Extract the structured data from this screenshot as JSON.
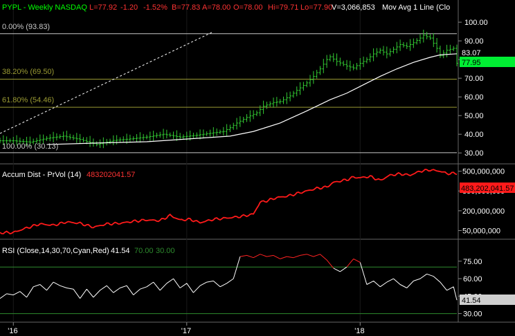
{
  "colors": {
    "background": "#000000",
    "grid": "#808080",
    "price_bars": "#33cc33",
    "moving_average": "#ffffff",
    "fib_lines": "#9a9a33",
    "trend_line": "#ffffff",
    "accum_dist": "#ff1a1a",
    "rsi_line": "#ffffff",
    "rsi_over": "#ff2222",
    "rsi_levels": "#2e8b2e",
    "label_green": "#00ff00",
    "label_red": "#ff3333",
    "label_orange": "#ff4d4d",
    "badge_bg": "#cfcfcf",
    "badge_green": "#00ee33"
  },
  "header": {
    "symbol": "PYPL - Weekly  NASDAQ",
    "last": "L=77.92",
    "change": "-1.20",
    "change_pct": "-1.52%",
    "bid": "B=77.83",
    "ask": "A=78.00",
    "open": "O=78.00",
    "high": "Hi=79.71",
    "low": "Lo=77.90",
    "volume": "V=3,066,853",
    "study": "Mov Avg 1 Line (Clo"
  },
  "price_panel": {
    "fib_labels": [
      "0.00% (93.83)",
      "38.20% (69.50)",
      "61.80% (54.46)",
      "100.00% (30.13)"
    ],
    "fib_values": [
      93.83,
      69.5,
      54.46,
      30.13
    ],
    "ma_badge": "83.07",
    "last_badge": "77.95",
    "ma_value": 83.07,
    "last_value": 77.95,
    "axis_ticks": [
      "100.00",
      "90.00",
      "80.00",
      "70.00",
      "60.00",
      "50.00",
      "40.00",
      "30.00"
    ],
    "tick_values": [
      100,
      90,
      80,
      70,
      60,
      50,
      40,
      30
    ]
  },
  "ad_panel": {
    "title": "Accum Dist - PrVol (14)",
    "value": "483202041.57",
    "badge": "483,202,041.57",
    "axis_ticks": [
      "500,000,000",
      "350,000,000",
      "200,000,000",
      "50,000,000"
    ],
    "tick_values": [
      500000000,
      350000000,
      200000000,
      50000000
    ]
  },
  "rsi_panel": {
    "title": "RSI (Close,14,30,70,Cyan,Red)",
    "value": "41.54",
    "upper": "70.00",
    "lower": "30.00",
    "badge": "41.54",
    "axis_ticks": [
      "75.00",
      "60.00",
      "45.00",
      "30.00"
    ],
    "tick_values": [
      75,
      60,
      45,
      30
    ]
  },
  "x_axis": {
    "labels": [
      "'16",
      "'17",
      "'18"
    ],
    "weeks": [
      0,
      52,
      104
    ]
  },
  "chart_data": [
    {
      "type": "line",
      "title": "PYPL - Weekly  NASDAQ",
      "series": [
        {
          "name": "Mov Avg 1 Line (Clo",
          "values": [
            [
              10,
              34.5
            ],
            [
              25,
              35.3
            ],
            [
              40,
              36.0
            ],
            [
              55,
              37.8
            ],
            [
              65,
              39.0
            ],
            [
              72,
              41.5
            ],
            [
              80,
              46.0
            ],
            [
              88,
              52.5
            ],
            [
              95,
              58.5
            ],
            [
              100,
              62.0
            ],
            [
              105,
              66.5
            ],
            [
              110,
              71.0
            ],
            [
              115,
              75.0
            ],
            [
              120,
              78.5
            ],
            [
              125,
              81.2
            ],
            [
              128,
              82.5
            ],
            [
              133,
              83.07
            ]
          ]
        }
      ],
      "price_path": [
        [
          0,
          36.5
        ],
        [
          5,
          35.8
        ],
        [
          10,
          37.8
        ],
        [
          15,
          39.0
        ],
        [
          20,
          37.2
        ],
        [
          25,
          34.5
        ],
        [
          30,
          36.7
        ],
        [
          35,
          37.5
        ],
        [
          40,
          38.5
        ],
        [
          45,
          40.0
        ],
        [
          50,
          38.5
        ],
        [
          55,
          39.5
        ],
        [
          60,
          40.8
        ],
        [
          63,
          41.5
        ],
        [
          65,
          43.5
        ],
        [
          67,
          46.0
        ],
        [
          70,
          49.0
        ],
        [
          73,
          51.5
        ],
        [
          75,
          55.0
        ],
        [
          78,
          57.0
        ],
        [
          80,
          57.5
        ],
        [
          83,
          60.5
        ],
        [
          85,
          63.5
        ],
        [
          88,
          67.5
        ],
        [
          90,
          71.0
        ],
        [
          92,
          75.0
        ],
        [
          94,
          80.0
        ],
        [
          95,
          81.5
        ],
        [
          97,
          79.0
        ],
        [
          100,
          76.5
        ],
        [
          102,
          75.5
        ],
        [
          104,
          78.0
        ],
        [
          106,
          80.0
        ],
        [
          108,
          83.0
        ],
        [
          110,
          85.0
        ],
        [
          112,
          83.0
        ],
        [
          114,
          85.5
        ],
        [
          116,
          88.0
        ],
        [
          118,
          87.0
        ],
        [
          120,
          89.0
        ],
        [
          122,
          91.5
        ],
        [
          123,
          93.0
        ],
        [
          125,
          91.5
        ],
        [
          127,
          86.0
        ],
        [
          128,
          82.0
        ],
        [
          130,
          85.0
        ],
        [
          132,
          86.0
        ],
        [
          133,
          78.0
        ]
      ],
      "fib_levels": [
        93.83,
        69.5,
        54.46,
        30.13
      ],
      "ylim": [
        26,
        103
      ],
      "x_range_weeks": [
        -4,
        133
      ]
    },
    {
      "type": "line",
      "title": "Accum Dist - PrVol (14)",
      "series": [
        {
          "name": "Accum Dist - PrVol (14)",
          "values": [
            [
              -4,
              33000000
            ],
            [
              0,
              35000000
            ],
            [
              4,
              70000000
            ],
            [
              8,
              100000000
            ],
            [
              12,
              90000000
            ],
            [
              16,
              115000000
            ],
            [
              20,
              105000000
            ],
            [
              24,
              75000000
            ],
            [
              28,
              100000000
            ],
            [
              32,
              105000000
            ],
            [
              36,
              120000000
            ],
            [
              40,
              130000000
            ],
            [
              44,
              125000000
            ],
            [
              47,
              165000000
            ],
            [
              50,
              130000000
            ],
            [
              53,
              135000000
            ],
            [
              56,
              110000000
            ],
            [
              60,
              135000000
            ],
            [
              62,
              140000000
            ],
            [
              66,
              150000000
            ],
            [
              69,
              160000000
            ],
            [
              72,
              175000000
            ],
            [
              74,
              265000000
            ],
            [
              76,
              275000000
            ],
            [
              79,
              300000000
            ],
            [
              82,
              310000000
            ],
            [
              85,
              330000000
            ],
            [
              88,
              350000000
            ],
            [
              91,
              370000000
            ],
            [
              94,
              380000000
            ],
            [
              96,
              415000000
            ],
            [
              98,
              425000000
            ],
            [
              100,
              435000000
            ],
            [
              102,
              455000000
            ],
            [
              104,
              450000000
            ],
            [
              107,
              460000000
            ],
            [
              110,
              430000000
            ],
            [
              113,
              470000000
            ],
            [
              116,
              480000000
            ],
            [
              119,
              470000000
            ],
            [
              122,
              500000000
            ],
            [
              125,
              510000000
            ],
            [
              128,
              500000000
            ],
            [
              130,
              483000000
            ],
            [
              133,
              483202041.57
            ]
          ]
        }
      ],
      "ylim": [
        0,
        540000000
      ]
    },
    {
      "type": "line",
      "title": "RSI (Close,14,30,70,Cyan,Red)",
      "series": [
        {
          "name": "RSI (Close,14,30,70,Cyan,Red)",
          "values": [
            [
              -4,
              43
            ],
            [
              -2,
              47
            ],
            [
              0,
              46
            ],
            [
              2,
              49
            ],
            [
              4,
              44
            ],
            [
              6,
              53
            ],
            [
              8,
              55
            ],
            [
              10,
              50
            ],
            [
              12,
              57
            ],
            [
              14,
              54
            ],
            [
              16,
              52
            ],
            [
              18,
              51
            ],
            [
              20,
              43
            ],
            [
              22,
              51
            ],
            [
              24,
              44
            ],
            [
              26,
              50
            ],
            [
              28,
              54
            ],
            [
              30,
              48
            ],
            [
              32,
              52
            ],
            [
              34,
              54
            ],
            [
              36,
              46
            ],
            [
              38,
              51
            ],
            [
              40,
              53
            ],
            [
              42,
              57
            ],
            [
              44,
              50
            ],
            [
              46,
              56
            ],
            [
              48,
              60
            ],
            [
              50,
              52
            ],
            [
              52,
              56
            ],
            [
              54,
              48
            ],
            [
              56,
              54
            ],
            [
              58,
              57
            ],
            [
              60,
              58
            ],
            [
              62,
              53
            ],
            [
              64,
              56
            ],
            [
              66,
              60
            ],
            [
              68,
              79
            ],
            [
              70,
              80
            ],
            [
              72,
              78
            ],
            [
              74,
              81
            ],
            [
              76,
              79
            ],
            [
              78,
              80
            ],
            [
              80,
              77
            ],
            [
              82,
              79
            ],
            [
              84,
              78
            ],
            [
              86,
              80
            ],
            [
              88,
              81
            ],
            [
              90,
              79
            ],
            [
              92,
              81
            ],
            [
              94,
              76
            ],
            [
              96,
              69
            ],
            [
              98,
              66
            ],
            [
              100,
              70
            ],
            [
              102,
              77
            ],
            [
              104,
              74
            ],
            [
              106,
              55
            ],
            [
              108,
              58
            ],
            [
              110,
              53
            ],
            [
              112,
              57
            ],
            [
              114,
              60
            ],
            [
              116,
              55
            ],
            [
              118,
              52
            ],
            [
              120,
              58
            ],
            [
              122,
              60
            ],
            [
              124,
              64
            ],
            [
              126,
              62
            ],
            [
              128,
              57
            ],
            [
              130,
              50
            ],
            [
              132,
              53
            ],
            [
              133,
              41.54
            ]
          ]
        }
      ],
      "levels": [
        70,
        30
      ],
      "ylim": [
        25,
        82
      ]
    }
  ]
}
